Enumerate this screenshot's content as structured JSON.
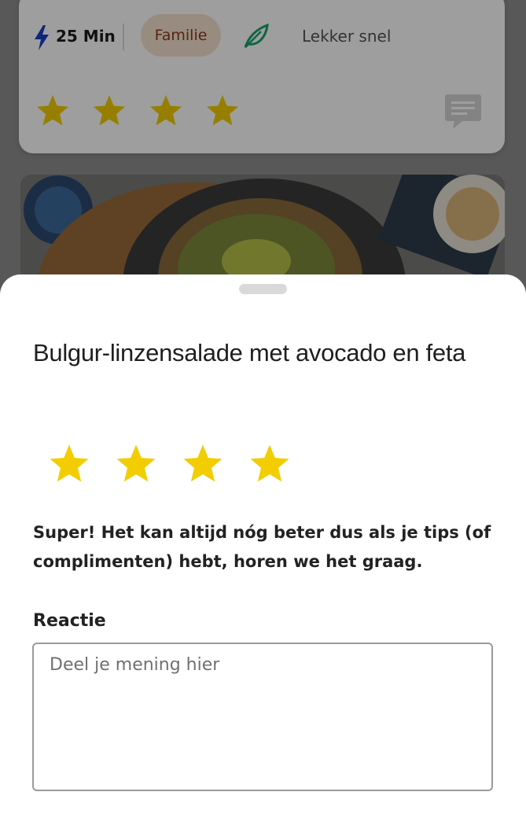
{
  "recipe_meta": {
    "time": "25 Min",
    "tag": "Familie",
    "quick_label": "Lekker snel",
    "rating": 4,
    "bolt_icon": "lightning-bolt-icon",
    "leaf_icon": "leaf-icon",
    "comment_icon": "comment-icon"
  },
  "rating_sheet": {
    "title": "Bulgur-linzensalade met avocado en feta",
    "selected_stars": 4,
    "feedback": "Super! Het kan altijd nóg beter dus als je tips (of complimenten) hebt, horen we het graag.",
    "comment_label": "Reactie",
    "comment_placeholder": "Deel je mening hier",
    "comment_value": ""
  },
  "colors": {
    "star": "#f2cd00",
    "brand_pill_bg": "#f6e2cf",
    "brand_pill_text": "#8b3b1b",
    "bolt": "#1a3ec8",
    "leaf": "#17a36a"
  }
}
